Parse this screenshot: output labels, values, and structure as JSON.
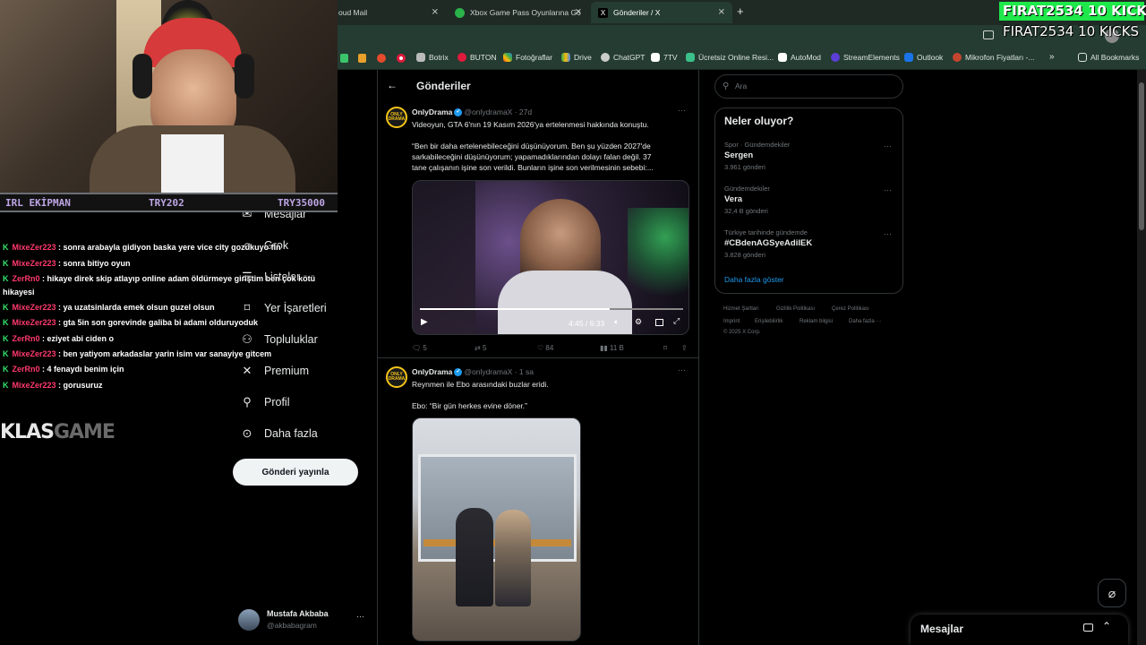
{
  "browser": {
    "tabs": [
      {
        "label": "oud Mail"
      },
      {
        "label": "Xbox Game Pass Oyunlarına Gö"
      },
      {
        "label": "Gönderiler / X"
      }
    ],
    "new_tab": "+",
    "bookmarks": [
      "Botrix",
      "BUTON",
      "Fotoğraflar",
      "Drive",
      "ChatGPT",
      "7TV",
      "Ücretsiz Online Resi...",
      "AutoMod",
      "StreamElements",
      "Outlook",
      "Mikrofon Fiyatları -..."
    ],
    "all_bookmarks": "All Bookmarks"
  },
  "overlay": {
    "kicks_bar": "FIRAT2534  10 KICKS",
    "kicks_text": "FIRAT2534  10 KICKS",
    "banner": {
      "left": "IRL EKİPMAN",
      "mid": "TRY202",
      "right": "TRY35000"
    },
    "brand_a": "KLAS",
    "brand_b": "GAME"
  },
  "chat": [
    {
      "user": "MixeZer223",
      "msg": " : sonra arabayla gidiyon baska yere vice city gozukuyo fln"
    },
    {
      "user": "MixeZer223",
      "msg": " : sonra bitiyo oyun"
    },
    {
      "user": "ZerRn0",
      "msg": " : hikaye direk skip atlayıp online adam öldürmeye giriştim ben çok kötü"
    },
    {
      "user": "",
      "msg": "hikayesi"
    },
    {
      "user": "MixeZer223",
      "msg": " : ya uzatsinlarda emek olsun guzel olsun"
    },
    {
      "user": "MixeZer223",
      "msg": " : gta 5in son gorevinde galiba bi adami olduruyoduk"
    },
    {
      "user": "ZerRn0",
      "msg": " : eziyet abi ciden o"
    },
    {
      "user": "MixeZer223",
      "msg": " : ben yatiyom arkadaslar yarin isim var sanayiye gitcem"
    },
    {
      "user": "ZerRn0",
      "msg": " : 4 fenaydı benim için"
    },
    {
      "user": "MixeZer223",
      "msg": " : gorusuruz"
    }
  ],
  "nav": {
    "items": [
      "Mesajlar",
      "Grok",
      "Listeler",
      "Yer İşaretleri",
      "Topluluklar",
      "Premium",
      "Profil",
      "Daha fazla"
    ],
    "post_button": "Gönderi yayınla",
    "account": {
      "name": "Mustafa Akbaba",
      "handle": "@akbabagram"
    }
  },
  "main": {
    "header": "Gönderiler",
    "tweets": [
      {
        "name": "OnlyDrama",
        "handle": "@onlydramaX · 27d",
        "avatar_text": "ONLY DRAMA",
        "lines": [
          "Videoyun, GTA 6'nın 19 Kasım 2026'ya ertelenmesi hakkında konuştu.",
          "",
          "“Ben bir daha ertelenebileceğini düşünüyorum. Ben şu yüzden 2027'de",
          "sarkabileceğini düşünüyorum; yapamadıklarından dolayı falan değil. 37",
          "tane çalışanın işine son verildi. Bunların işine son verilmesinin sebebi:..."
        ],
        "video_time": "4:45 / 6:33",
        "replies": "5",
        "reposts": "5",
        "likes": "84",
        "views": "11 B"
      },
      {
        "name": "OnlyDrama",
        "handle": "@onlydramaX · 1 sa",
        "avatar_text": "ONLY DRAMA",
        "lines": [
          "Reynmen ile Ebo arasındaki buzlar eridi.",
          "",
          "Ebo: “Bir gün herkes evine döner.”"
        ]
      }
    ]
  },
  "sidebar": {
    "search_placeholder": "Ara",
    "trends_title": "Neler oluyor?",
    "trends": [
      {
        "meta": "Spor · Gündemdekiler",
        "name": "Sergen",
        "count": "3.961 gönderi"
      },
      {
        "meta": "Gündemdekiler",
        "name": "Vera",
        "count": "32,4 B gönderi"
      },
      {
        "meta": "Türkiye tarihinde gündemde",
        "name": "#CBdenAGSyeAdilEK",
        "count": "3.828 gönderi"
      }
    ],
    "show_more": "Daha fazla göster",
    "footer": [
      "Hizmet Şartları",
      "Gizlilik Politikası",
      "Çerez Politikası",
      "Imprint",
      "Erişilebilirlik",
      "Reklam bilgisi",
      "Daha fazla ···",
      "© 2025 X Corp."
    ]
  },
  "messages": {
    "title": "Mesajlar"
  }
}
